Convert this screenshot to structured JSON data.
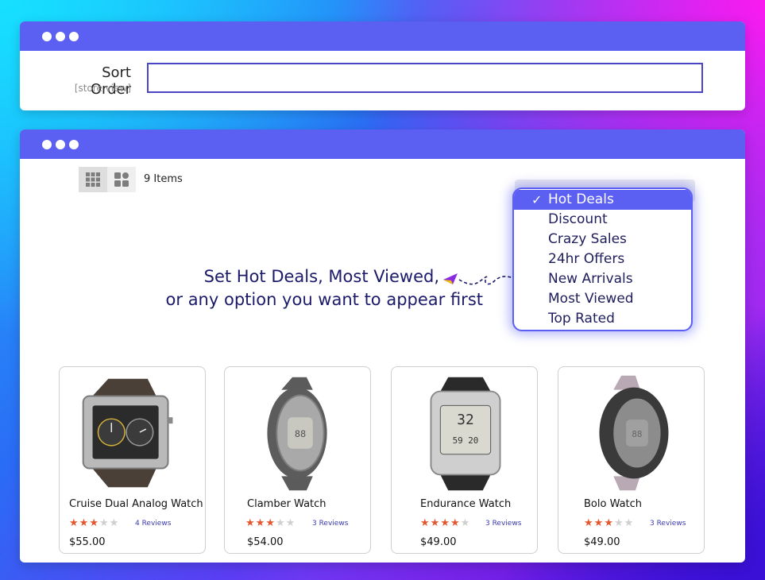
{
  "window_top": {
    "sort_label": "Sort Order",
    "sort_sublabel": "[store view]",
    "sort_value": ""
  },
  "window_main": {
    "item_count": "9 Items",
    "dropdown": {
      "options": [
        "Hot Deals",
        "Discount",
        "Crazy Sales",
        "24hr Offers",
        "New Arrivals",
        "Most Viewed",
        "Top Rated"
      ],
      "selected": "Hot Deals"
    },
    "callout_line1": "Set Hot Deals, Most Viewed,",
    "callout_line2": "or any option you want to appear first",
    "products": [
      {
        "name": "Cruise Dual Analog Watch",
        "rating": 3,
        "reviews": "4 Reviews",
        "price": "$55.00"
      },
      {
        "name": "Clamber Watch",
        "rating": 3,
        "reviews": "3 Reviews",
        "price": "$54.00"
      },
      {
        "name": "Endurance Watch",
        "rating": 4,
        "reviews": "3 Reviews",
        "price": "$49.00"
      },
      {
        "name": "Bolo Watch",
        "rating": 3,
        "reviews": "3 Reviews",
        "price": "$49.00"
      }
    ]
  },
  "colors": {
    "accent": "#5b5ff2",
    "text_dark": "#1b1a6b",
    "star_on": "#e4572e",
    "star_off": "#cfcfcf",
    "review_link": "#3b3bb0"
  },
  "icons": {
    "view_grid": "grid-view-icon",
    "view_list": "list-view-icon",
    "checkmark": "check-icon",
    "paper_plane": "paper-plane-icon",
    "star": "star-icon"
  }
}
